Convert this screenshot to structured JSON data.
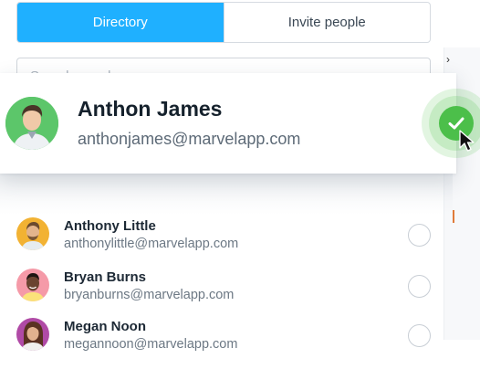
{
  "tabs": {
    "directory_label": "Directory",
    "invite_label": "Invite people"
  },
  "search": {
    "placeholder": "Search people"
  },
  "selected_contact": {
    "name": "Anthon James",
    "email": "anthonjames@marvelapp.com",
    "selected": true,
    "check_color": "#4cbf4a"
  },
  "contacts": [
    {
      "name": "Anthony Little",
      "email": "anthonylittle@marvelapp.com",
      "selected": false,
      "avatar_bg": "#f2b233"
    },
    {
      "name": "Bryan Burns",
      "email": "bryanburns@marvelapp.com",
      "selected": false,
      "avatar_bg": "#f59aa8"
    },
    {
      "name": "Megan Noon",
      "email": "megannoon@marvelapp.com",
      "selected": false,
      "avatar_bg": "#b04aa6"
    }
  ],
  "colors": {
    "accent": "#1fb0ff",
    "selected_avatar_bg": "#5cc66a"
  },
  "icons": {
    "check": "check-icon",
    "cursor": "mouse-pointer-icon"
  }
}
